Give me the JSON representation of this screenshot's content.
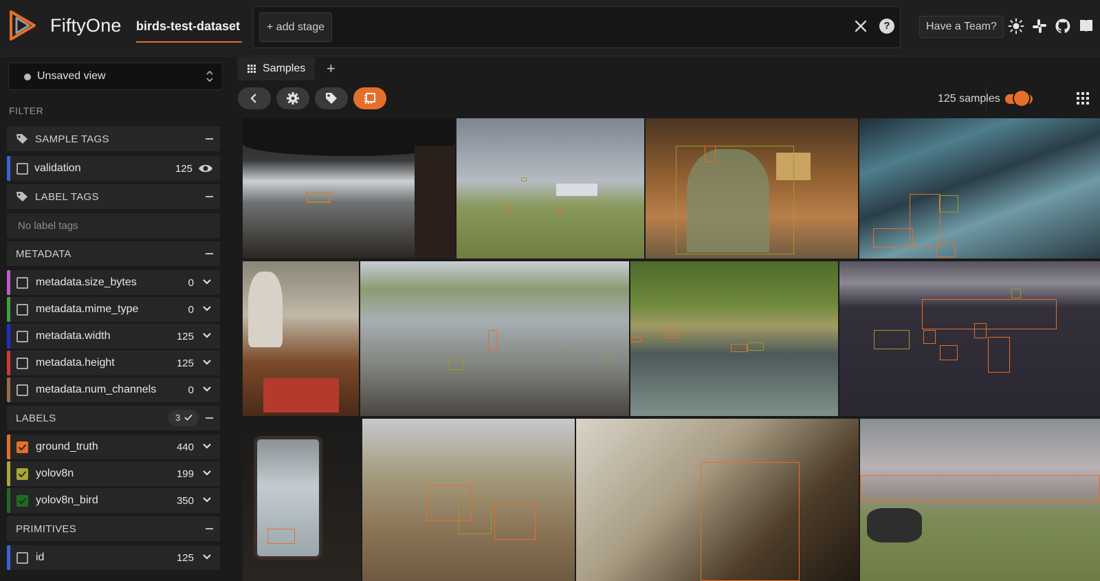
{
  "header": {
    "brand": "FiftyOne",
    "dataset": "birds-test-dataset",
    "add_stage": "+ add stage",
    "team_button": "Have a Team?",
    "icons": [
      "fiftyone-logo-icon",
      "close-icon",
      "help-icon",
      "sun-icon",
      "slack-icon",
      "github-icon",
      "book-icon"
    ]
  },
  "sidebar": {
    "view_label": "Unsaved view",
    "filter_title": "FILTER",
    "groups": {
      "sample_tags": "SAMPLE TAGS",
      "label_tags": "LABEL TAGS",
      "metadata": "METADATA",
      "labels": "LABELS",
      "primitives": "PRIMITIVES"
    },
    "sample_tags": [
      {
        "label": "validation",
        "count": "125",
        "color": "#3b63d6"
      }
    ],
    "no_label_tags": "No label tags",
    "metadata": [
      {
        "label": "metadata.size_bytes",
        "count": "0",
        "color": "#c05ad1"
      },
      {
        "label": "metadata.mime_type",
        "count": "0",
        "color": "#3fa13c"
      },
      {
        "label": "metadata.width",
        "count": "125",
        "color": "#1f2fc9"
      },
      {
        "label": "metadata.height",
        "count": "125",
        "color": "#d03a35"
      },
      {
        "label": "metadata.num_channels",
        "count": "0",
        "color": "#9a6b47"
      }
    ],
    "labels_badge": "3",
    "labels": [
      {
        "label": "ground_truth",
        "count": "440",
        "color": "#e56f2a",
        "checked": true
      },
      {
        "label": "yolov8n",
        "count": "199",
        "color": "#a8a833",
        "checked": true
      },
      {
        "label": "yolov8n_bird",
        "count": "350",
        "color": "#1f6b22",
        "checked": true
      }
    ],
    "primitives": [
      {
        "label": "id",
        "count": "125",
        "color": "#3b63d6"
      }
    ]
  },
  "main": {
    "tab_label": "Samples",
    "tab_add": "+",
    "sample_count": "125 samples",
    "accent": "#e56f2a"
  }
}
